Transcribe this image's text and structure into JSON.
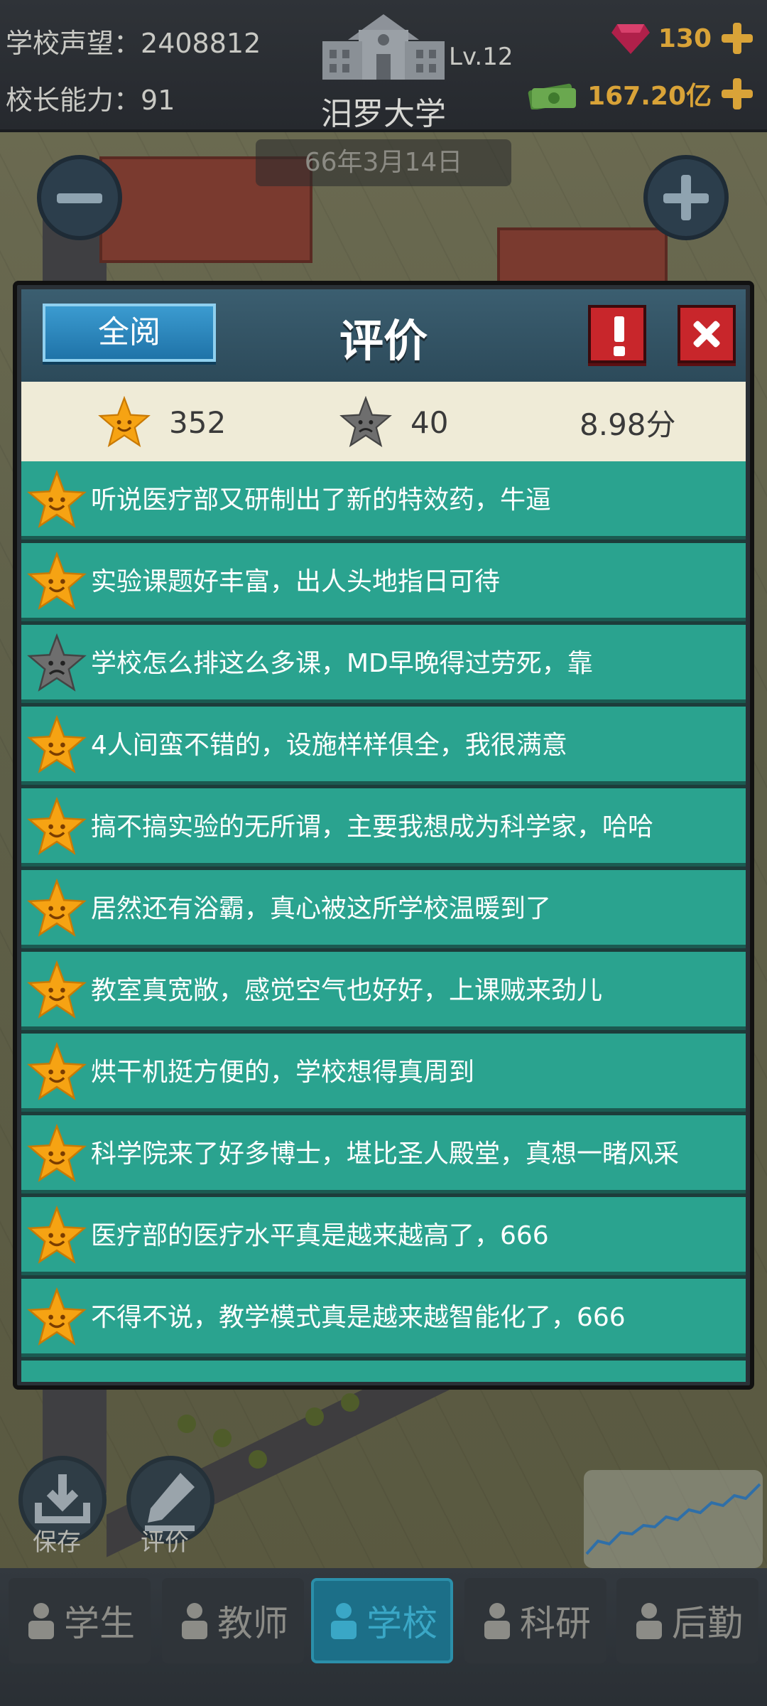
{
  "header": {
    "reputation_label": "学校声望：",
    "reputation_value": "2408812",
    "ability_label": "校长能力：",
    "ability_value": "91",
    "level": "Lv.12",
    "school_name": "汨罗大学",
    "gems": "130",
    "money": "167.20亿",
    "date": "66年3月14日"
  },
  "modal": {
    "read_all_label": "全阅",
    "title": "评价",
    "summary": {
      "good_count": "352",
      "bad_count": "40",
      "score": "8.98分"
    },
    "reviews": [
      {
        "type": "good",
        "text": "听说医疗部又研制出了新的特效药，牛逼"
      },
      {
        "type": "good",
        "text": "实验课题好丰富，出人头地指日可待"
      },
      {
        "type": "bad",
        "text": "学校怎么排这么多课，MD早晚得过劳死，靠"
      },
      {
        "type": "good",
        "text": "4人间蛮不错的，设施样样俱全，我很满意"
      },
      {
        "type": "good",
        "text": "搞不搞实验的无所谓，主要我想成为科学家，哈哈"
      },
      {
        "type": "good",
        "text": "居然还有浴霸，真心被这所学校温暖到了"
      },
      {
        "type": "good",
        "text": "教室真宽敞，感觉空气也好好，上课贼来劲儿"
      },
      {
        "type": "good",
        "text": "烘干机挺方便的，学校想得真周到"
      },
      {
        "type": "good",
        "text": "科学院来了好多博士，堪比圣人殿堂，真想一睹风采"
      },
      {
        "type": "good",
        "text": "医疗部的医疗水平真是越来越高了，666"
      },
      {
        "type": "good",
        "text": "不得不说，教学模式真是越来越智能化了，666"
      }
    ]
  },
  "tools": {
    "save_label": "保存",
    "rate_label": "评价"
  },
  "nav": {
    "tabs": [
      "学生",
      "教师",
      "学校",
      "科研",
      "后勤"
    ],
    "active": 2
  },
  "colors": {
    "review_row": "#2aa38f",
    "good_star": "#f6a313",
    "bad_star": "#6e6e6e",
    "gold_text": "#d9a338"
  },
  "icons": {
    "good_star": "smiling-gold-star-icon",
    "bad_star": "frowning-gray-star-icon"
  }
}
